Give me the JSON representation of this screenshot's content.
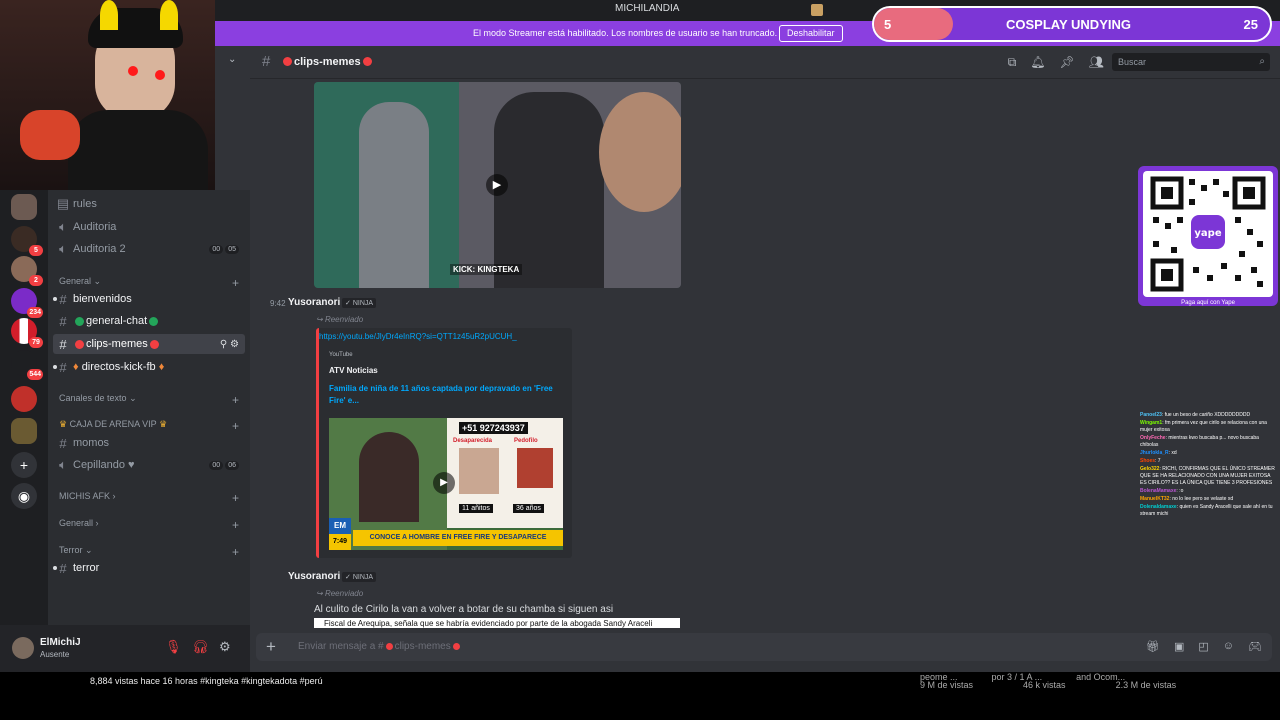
{
  "window": {
    "title": "MICHILANDIA"
  },
  "streamer_banner": {
    "message": "El modo Streamer está habilitado. Los nombres de usuario se han truncado.",
    "button": "Deshabilitar"
  },
  "servers": [
    {
      "badge": ""
    },
    {
      "badge": "5"
    },
    {
      "badge": "2"
    },
    {
      "badge": "234"
    },
    {
      "badge": "79"
    },
    {
      "badge": "544"
    },
    {
      "badge": ""
    },
    {
      "badge": ""
    }
  ],
  "channels": {
    "items": [
      {
        "label": "rules",
        "icon": "rules"
      },
      {
        "label": "Auditoria",
        "icon": "speaker"
      },
      {
        "label": "Auditoria 2",
        "icon": "speaker",
        "voice": [
          "00",
          "05"
        ]
      }
    ],
    "cat_general": "General",
    "general_items": [
      {
        "label": "bienvenidos"
      },
      {
        "label": "general-chat"
      },
      {
        "label": "clips-memes"
      },
      {
        "label": "directos-kick-fb"
      }
    ],
    "cat_text": "Canales de texto",
    "cat_caja": "CAJA DE ARENA VIP",
    "caja_items": [
      {
        "label": "momos"
      },
      {
        "label": "Cepillando",
        "voice": [
          "00",
          "06"
        ]
      }
    ],
    "cat_michis": "MICHIS AFK",
    "cat_generall": "Generall",
    "cat_terror": "Terror",
    "terror_items": [
      {
        "label": "terror"
      }
    ]
  },
  "user": {
    "name": "ElMichiJ",
    "status": "Ausente"
  },
  "chat": {
    "channel_name": "clips-memes",
    "search_placeholder": "Buscar",
    "messages": [
      {
        "time": "9:42",
        "author": "Yusoranori",
        "tag": "NINJA",
        "forwarded": "Reenviado",
        "link": "https://youtu.be/JlyDr4eInRQ?si=QTT1z45uR2pUCUH_",
        "embed": {
          "provider": "YouTube",
          "author": "ATV Noticias",
          "title": "Familia de niña de 11 años captada por depravado en 'Free Fire' e...",
          "thumb_phone": "+51 927243937",
          "thumb_left": "Desaparecida",
          "thumb_right": "Pedofilo",
          "thumb_age_left": "11 añitos",
          "thumb_age_right": "36 años",
          "thumb_headline": "CONOCE A HOMBRE EN FREE FIRE Y DESAPARECE",
          "thumb_brand": "EM",
          "thumb_time": "7:49"
        }
      },
      {
        "author": "Yusoranori",
        "tag": "NINJA",
        "forwarded": "Reenviado",
        "text": "Al culito de Cirilo la van a volver a botar de su chamba si siguen asi",
        "caption": "Fiscal de Arequipa, señala que se habría evidenciado por parte de la abogada Sandy Araceli"
      }
    ],
    "video_caption": "KICK: KINGTEKA",
    "composer_placeholder": "Enviar mensaje a #",
    "composer_channel": "clips-memes"
  },
  "overlay": {
    "goal": {
      "current": "5",
      "label": "COSPLAY UNDYING",
      "total": "25",
      "progress": 0.2
    },
    "qr_caption": "Paga aquí con Yape",
    "twitch_chat": [
      {
        "user": "Panoel23",
        "text": "fue un beso de cariño XDDDDDDDDD"
      },
      {
        "user": "Wingam1",
        "text": "fm primera vez que cirilo se relaciona con una mujer exitosa"
      },
      {
        "user": "OnlyFeche",
        "text": "mientras kwo buscaba p... novo buscaba chibolas"
      },
      {
        "user": "Jhurlokla_R",
        "text": "xd"
      },
      {
        "user": "Shoes",
        "text": "7"
      },
      {
        "user": "Gelo322",
        "text": "RICHI, CONFIRMAS QUE EL ÚNICO STREAMER QUE SE HA RELACIONADO CON UNA MUJER EXITOSA ES CIRILO?? ES LA ÚNICA QUE TIENE 3 PROFESIONES"
      },
      {
        "user": "BolenaMamaxe",
        "text": ":o"
      },
      {
        "user": "ManuelKT32",
        "text": "no lo lee pero se velaste xd"
      },
      {
        "user": "Dolenaldamaxe",
        "text": "quien es Sandy Aracelli que sale ahí en tu stream michi"
      }
    ]
  },
  "youtube": {
    "info": "8,884 vistas  hace 16 horas  #kingteka #kingtekadota #perú",
    "cards": [
      "peome ...",
      "por 3 / 1 A ...",
      "and Ocom..."
    ],
    "stats": [
      "9 M de vistas",
      "46 k vistas",
      "2.3 M de vistas"
    ]
  },
  "colors": {
    "brand": "#8b3fe0",
    "accent_link": "#00a8fc",
    "unread_badge": "#f23f42"
  }
}
